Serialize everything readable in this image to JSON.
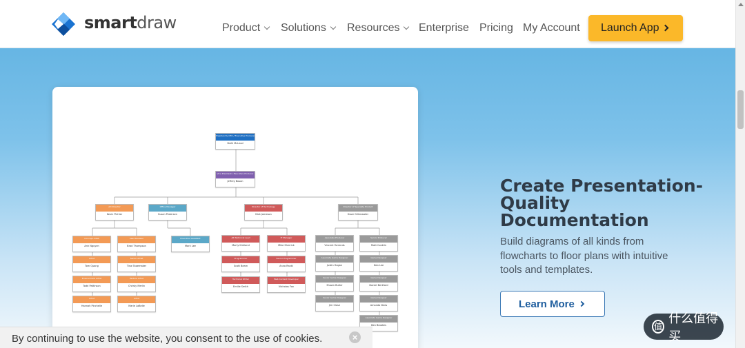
{
  "header": {
    "brand_part1": "smart",
    "brand_part2": "draw",
    "nav": [
      {
        "label": "Product",
        "dropdown": true
      },
      {
        "label": "Solutions",
        "dropdown": true
      },
      {
        "label": "Resources",
        "dropdown": true
      },
      {
        "label": "Enterprise",
        "dropdown": false
      },
      {
        "label": "Pricing",
        "dropdown": false
      },
      {
        "label": "My Account",
        "dropdown": false
      }
    ],
    "launch_label": "Launch App"
  },
  "hero": {
    "headline": "Create Presentation-Quality Documentation",
    "subtext": "Build diagrams of all kinds from flowcharts to floor plans with intuitive tools and templates.",
    "learn_more_label": "Learn More"
  },
  "cookie": {
    "text": "By continuing to use the website, you consent to the use of cookies.",
    "close_glyph": "×"
  },
  "watermark": {
    "glyph": "值",
    "text": "什么值得买"
  },
  "colors": {
    "accent_yellow": "#fbb829",
    "blue_link": "#1f5e9e",
    "org_blue": "#1f6fc2",
    "org_purple": "#7f5fae",
    "org_orange": "#f39a55",
    "org_teal": "#5ba8c8",
    "org_red": "#d05a5a",
    "org_gray": "#9a9a9a"
  },
  "org_chart": {
    "ceo": {
      "title": "President & CEO / Executive Producer",
      "name": "Brett McLeod"
    },
    "vp": {
      "title": "Vice President / Executive Producer",
      "name": "Jeffrey Boson"
    },
    "departments": [
      {
        "title": "Art Director",
        "name": "Kevin Pichler",
        "color": "orange"
      },
      {
        "title": "Office Manager",
        "name": "Susan Pedersen",
        "color": "teal"
      },
      {
        "title": "Director of Technology",
        "name": "Nick Jameson",
        "color": "red"
      },
      {
        "title": "Director of Specialty Product",
        "name": "Dave Gillenwater",
        "color": "gray"
      }
    ],
    "orange_left": [
      {
        "title": "Concept Artist",
        "name": "Anh Nguyen"
      },
      {
        "title": "Artist",
        "name": "Tom Quang"
      },
      {
        "title": "Environment Artist",
        "name": "Todd Pattinson"
      },
      {
        "title": "Artist",
        "name": "Hannah Pinchelle"
      }
    ],
    "orange_right": [
      {
        "title": "Lead Modeler",
        "name": "Brad Thompson"
      },
      {
        "title": "Senior Artist",
        "name": "Tina Shoemaker"
      },
      {
        "title": "Texture Artist",
        "name": "Christy Merlin"
      },
      {
        "title": "Artist",
        "name": "Marie LaBelle"
      }
    ],
    "teal_children": [
      {
        "title": "Executive Assistant",
        "name": "Mark Lee"
      }
    ],
    "red_left": [
      {
        "title": "AR Technical Lead",
        "name": "Marty Kirkland"
      },
      {
        "title": "Programmer",
        "name": "Scott Beam"
      },
      {
        "title": "Technical Writer",
        "name": "Emilie Smith"
      }
    ],
    "red_right": [
      {
        "title": "IT Manager",
        "name": "Mike Sherrick"
      },
      {
        "title": "Senior Programmer",
        "name": "Anna Rankl"
      },
      {
        "title": "Web Content Developer",
        "name": "Nicholas Fox"
      }
    ],
    "gray_left": [
      {
        "title": "Associate Producer",
        "name": "Vincent Yorrends"
      },
      {
        "title": "Associate Game Designer",
        "name": "Justin Hagan"
      },
      {
        "title": "Senior Game Designer",
        "name": "Shawn Butler"
      },
      {
        "title": "Senior Game Designer",
        "name": "Jim Close"
      }
    ],
    "gray_right": [
      {
        "title": "Senior Producer",
        "name": "Matt Conklin"
      },
      {
        "title": "Game Designer",
        "name": "Dan Lee"
      },
      {
        "title": "Game Designer",
        "name": "Daniel Berkford"
      },
      {
        "title": "Game Designer",
        "name": "Amanda Dees"
      },
      {
        "title": "Associate Game Designer",
        "name": "Ben Brookes"
      }
    ]
  }
}
